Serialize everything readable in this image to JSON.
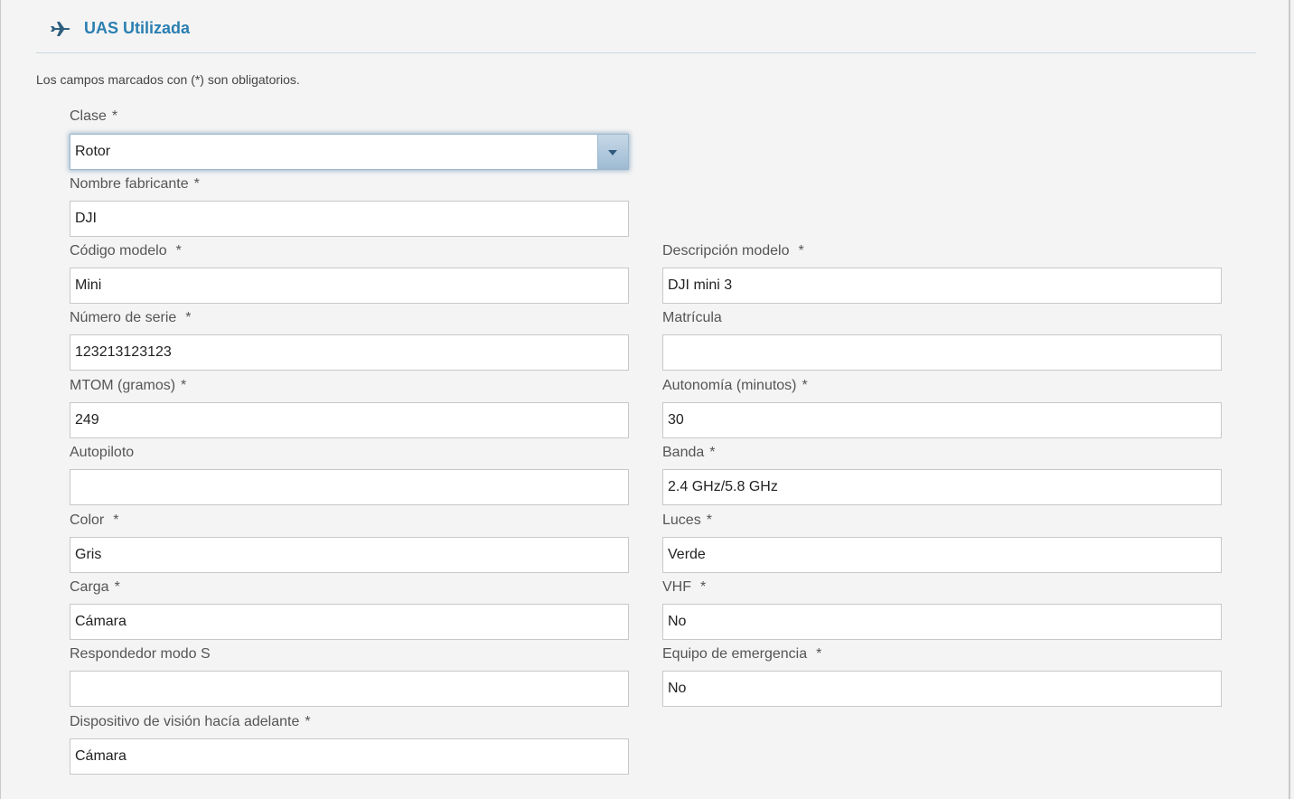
{
  "section": {
    "title": "UAS Utilizada",
    "icon": "airplane-icon"
  },
  "help_text": "Los campos marcados con (*) son obligatorios.",
  "required_mark": "*",
  "colors": {
    "title": "#2a7fb2",
    "focus_border": "#9bb8cf"
  },
  "fields": {
    "clase": {
      "label": "Clase",
      "value": "Rotor"
    },
    "nombre_fabricante": {
      "label": "Nombre fabricante",
      "value": "DJI"
    },
    "codigo_modelo": {
      "label": "Código modelo",
      "value": "Mini"
    },
    "descripcion_modelo": {
      "label": "Descripción modelo",
      "value": "DJI mini 3"
    },
    "numero_serie": {
      "label": "Número de serie",
      "value": "123213123123"
    },
    "matricula": {
      "label": "Matrícula",
      "value": ""
    },
    "mtom": {
      "label": "MTOM (gramos)",
      "value": "249"
    },
    "autonomia": {
      "label": "Autonomía (minutos)",
      "value": "30"
    },
    "autopiloto": {
      "label": "Autopiloto",
      "value": ""
    },
    "banda": {
      "label": "Banda",
      "value": "2.4 GHz/5.8 GHz"
    },
    "color": {
      "label": "Color",
      "value": "Gris"
    },
    "luces": {
      "label": "Luces",
      "value": "Verde"
    },
    "carga": {
      "label": "Carga",
      "value": "Cámara"
    },
    "vhf": {
      "label": "VHF",
      "value": "No"
    },
    "respondedor": {
      "label": "Respondedor modo S",
      "value": ""
    },
    "equipo_emergencia": {
      "label": "Equipo de emergencia",
      "value": "No"
    },
    "dispositivo_vision": {
      "label": "Dispositivo de visión hacía adelante",
      "value": "Cámara"
    }
  }
}
